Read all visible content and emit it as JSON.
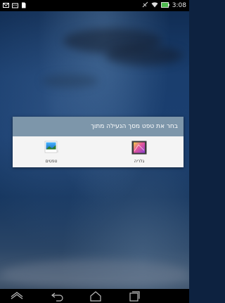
{
  "status_bar": {
    "time": "3:08",
    "left_icons": [
      "message-icon",
      "keyboard-icon",
      "sdcard-icon"
    ],
    "right_icons": [
      "signal-off-icon",
      "wifi-icon",
      "battery-icon"
    ]
  },
  "dialog": {
    "title": "בחר את טפט מסך הנעילה מתוך",
    "options": [
      {
        "label": "גלריה",
        "icon": "gallery-icon"
      },
      {
        "label": "טפטים",
        "icon": "wallpapers-icon"
      }
    ]
  },
  "nav_bar": {
    "buttons": [
      "collapse-icon",
      "back-icon",
      "home-icon",
      "recent-apps-icon"
    ]
  },
  "colors": {
    "dialog_header": "#7d96aa",
    "dialog_body": "#f4f4f4",
    "status_bar": "#000000"
  }
}
